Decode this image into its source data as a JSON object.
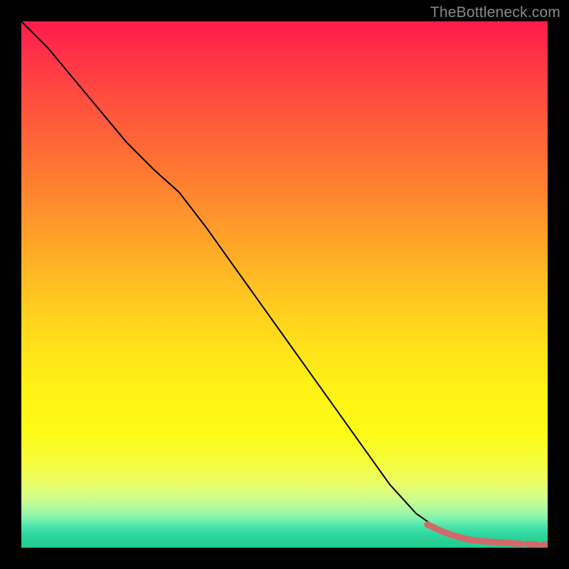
{
  "attribution": "TheBottleneck.com",
  "chart_data": {
    "type": "line",
    "title": "",
    "xlabel": "",
    "ylabel": "",
    "xlim": [
      0,
      100
    ],
    "ylim": [
      0,
      100
    ],
    "series": [
      {
        "name": "curve",
        "x": [
          0,
          5,
          10,
          15,
          20,
          25,
          30,
          35,
          40,
          45,
          50,
          55,
          60,
          65,
          70,
          75,
          80,
          82,
          85,
          88,
          90,
          93,
          96,
          100
        ],
        "y": [
          100,
          95,
          89,
          83,
          77,
          72,
          67.5,
          61,
          54,
          47,
          40,
          33,
          26,
          19,
          12,
          6.5,
          3,
          2.2,
          1.5,
          1.1,
          0.9,
          0.7,
          0.6,
          0.5
        ]
      },
      {
        "name": "highlighted-points",
        "x": [
          78,
          79.5,
          81,
          82.5,
          84,
          85,
          86.5,
          88,
          89.5,
          91,
          92.5,
          94,
          97,
          100
        ],
        "y": [
          4.0,
          3.3,
          2.7,
          2.2,
          1.8,
          1.55,
          1.35,
          1.2,
          1.1,
          1.0,
          0.9,
          0.8,
          0.65,
          0.5
        ]
      }
    ],
    "background_gradient": {
      "top": "#ff1a4d",
      "mid": "#ffe21a",
      "bottom": "#23cd8f"
    },
    "highlight_color": "#d06a6a",
    "line_color": "#000000"
  }
}
